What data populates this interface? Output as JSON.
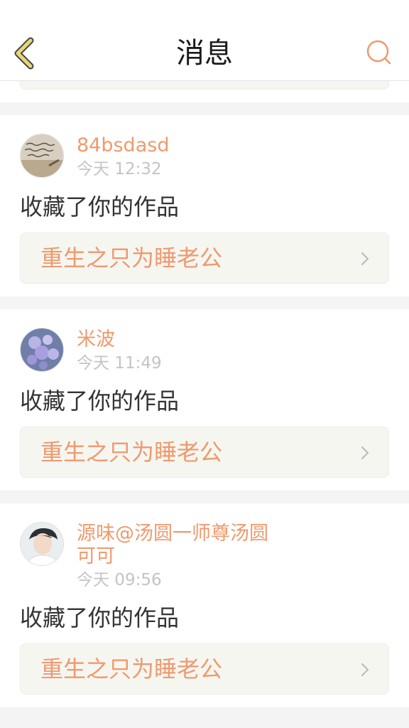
{
  "header": {
    "title": "消息",
    "back_icon": "chevron-left-icon",
    "search_icon": "search-icon"
  },
  "colors": {
    "accent": "#ef9a6e",
    "back_stroke": "#e8d67a",
    "box_bg": "#f6f6f1"
  },
  "messages": [
    {
      "username": "84bsdasd",
      "time": "今天 12:32",
      "action": "收藏了你的作品",
      "work_title": "重生之只为睡老公",
      "avatar_icon": "handwriting-avatar"
    },
    {
      "username": "米波",
      "time": "今天 11:49",
      "action": "收藏了你的作品",
      "work_title": "重生之只为睡老公",
      "avatar_icon": "flower-avatar"
    },
    {
      "username": "源味@汤圆一师尊汤圆可可",
      "time": "今天 09:56",
      "action": "收藏了你的作品",
      "work_title": "重生之只为睡老公",
      "avatar_icon": "person-avatar"
    }
  ]
}
